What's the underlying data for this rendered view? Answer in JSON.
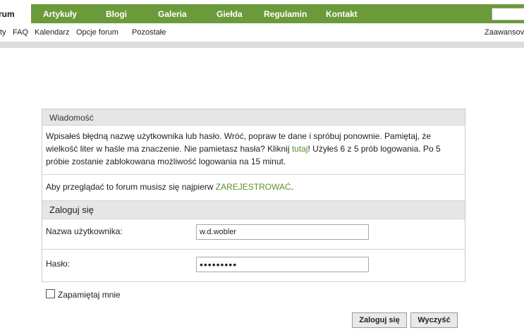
{
  "nav": {
    "forum_tab": "rum",
    "items": [
      "Artykuły",
      "Blogi",
      "Galeria",
      "Giełda",
      "Regulamin",
      "Kontakt"
    ]
  },
  "subnav": {
    "items": [
      "ty",
      "FAQ",
      "Kalendarz",
      "Opcje forum",
      "Pozostałe"
    ],
    "right": "Zaawansov"
  },
  "message": {
    "header": "Wiadomość",
    "text_part1": "Wpisałeś błędną nazwę użytkownika lub hasło. Wróć, popraw te dane i spróbuj ponownie. Pamiętaj, że wielkość liter w haśle ma znaczenie. Nie pamietasz hasła? Kliknij ",
    "link_here": "tutaj",
    "text_part2": "! Użyłeś 6 z 5 prób logowania. Po 5 próbie zostanie zablokowana możliwość logowania na 15 minut.",
    "register_prefix": "Aby przeglądać to forum musisz się najpierw ",
    "register_link": "ZAREJESTROWAĆ",
    "register_suffix": "."
  },
  "login": {
    "header": "Zaloguj się",
    "username_label": "Nazwa użytkownika:",
    "username_value": "w.d.wobler",
    "password_label": "Hasło:",
    "password_value": "•••••••••",
    "remember_label": "Zapamiętaj mnie",
    "submit_label": "Zaloguj się",
    "reset_label": "Wyczyść"
  },
  "colors": {
    "nav_green": "#6b9a3a",
    "link_green": "#5a8f2f",
    "header_gray": "#e6e6e6"
  }
}
